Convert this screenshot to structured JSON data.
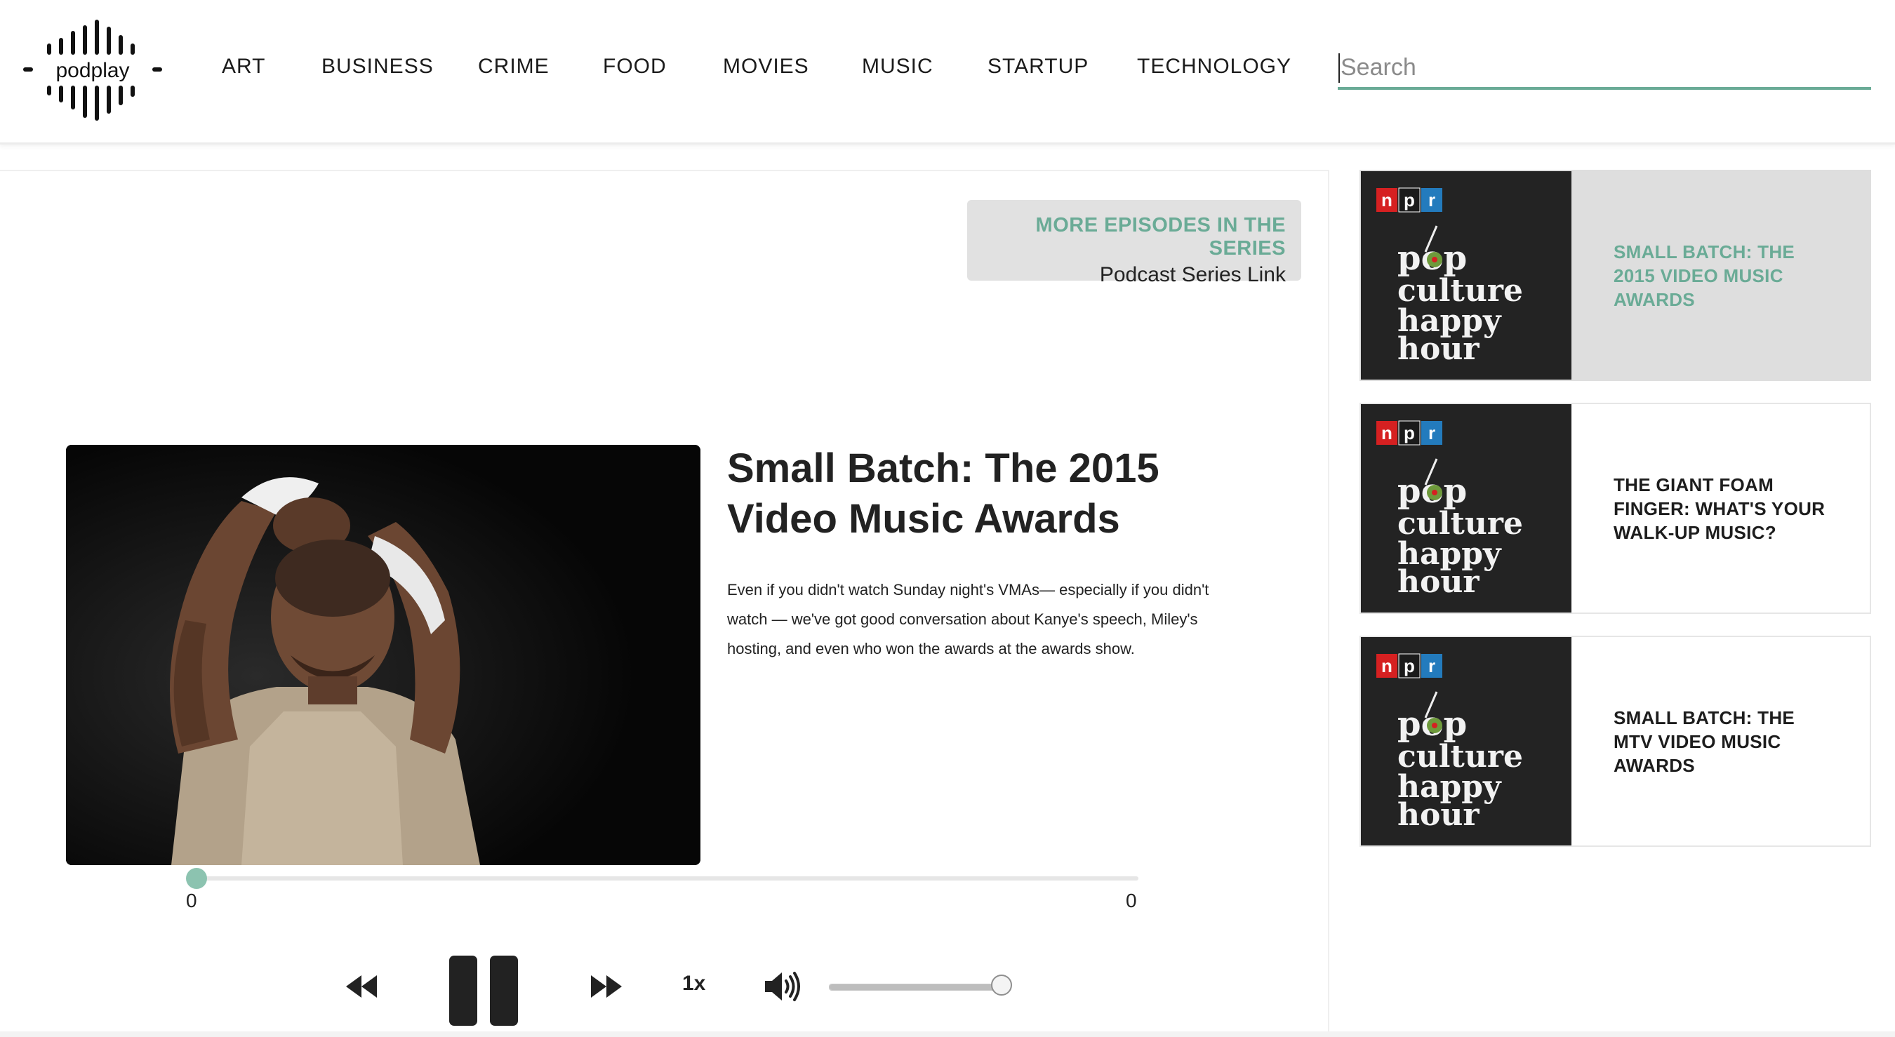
{
  "brand": {
    "logo_text": "podplay"
  },
  "nav": {
    "items": [
      {
        "label": "ART"
      },
      {
        "label": "BUSINESS"
      },
      {
        "label": "CRIME"
      },
      {
        "label": "FOOD"
      },
      {
        "label": "MOVIES"
      },
      {
        "label": "MUSIC"
      },
      {
        "label": "STARTUP"
      },
      {
        "label": "TECHNOLOGY"
      }
    ]
  },
  "search": {
    "placeholder": "Search",
    "value": ""
  },
  "series_box": {
    "title": "MORE EPISODES IN THE SERIES",
    "link_label": "Podcast Series Link"
  },
  "episode": {
    "title": "Small Batch: The 2015 Video Music Awards",
    "description": "Even if you didn't watch Sunday night's VMAs— especially if you didn't watch — we've got good conversation about Kanye's speech, Miley's hosting, and even who won the awards at the awards show.",
    "image_icon": "episode-photo"
  },
  "player": {
    "elapsed": "0",
    "duration": "0",
    "progress": 0,
    "speed_label": "1x",
    "volume": 1.0,
    "state": "playing",
    "icons": [
      "rewind-icon",
      "pause-icon",
      "fast-forward-icon",
      "volume-icon"
    ]
  },
  "sidebar": {
    "cards": [
      {
        "title": "SMALL BATCH: THE 2015 VIDEO MUSIC AWARDS",
        "active": true,
        "thumb": {
          "badge_letters": [
            "n",
            "p",
            "r"
          ],
          "show_lines": [
            "pop",
            "culture",
            "happy",
            "hour"
          ]
        }
      },
      {
        "title": "THE GIANT FOAM FINGER: WHAT'S YOUR WALK-UP MUSIC?",
        "active": false,
        "thumb": {
          "badge_letters": [
            "n",
            "p",
            "r"
          ],
          "show_lines": [
            "pop",
            "culture",
            "happy",
            "hour"
          ]
        }
      },
      {
        "title": "SMALL BATCH: THE MTV VIDEO MUSIC AWARDS",
        "active": false,
        "thumb": {
          "badge_letters": [
            "n",
            "p",
            "r"
          ],
          "show_lines": [
            "pop",
            "culture",
            "happy",
            "hour"
          ]
        }
      }
    ]
  },
  "colors": {
    "accent": "#6aab96",
    "npr_red": "#d62021",
    "npr_blue": "#237bbd",
    "thumb_bg": "#232323",
    "olive_green": "#6e9a3b"
  }
}
